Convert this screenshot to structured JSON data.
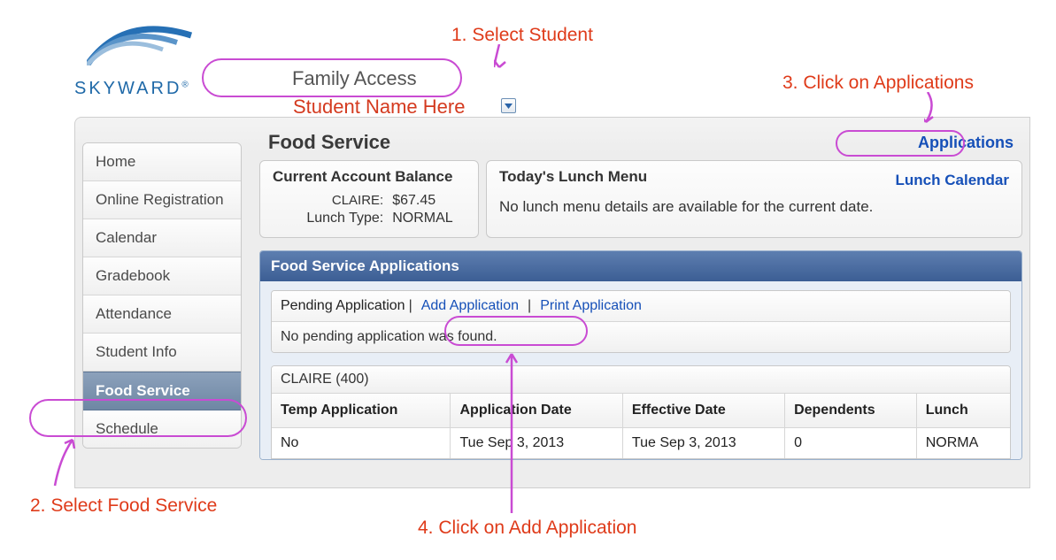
{
  "brand": {
    "name": "SKYWARD",
    "app_title": "Family Access"
  },
  "student_selector": {
    "label": "Student Name Here"
  },
  "sidebar": {
    "items": [
      {
        "label": "Home"
      },
      {
        "label": "Online Registration"
      },
      {
        "label": "Calendar"
      },
      {
        "label": "Gradebook"
      },
      {
        "label": "Attendance"
      },
      {
        "label": "Student Info"
      },
      {
        "label": "Food Service"
      },
      {
        "label": "Schedule"
      }
    ],
    "active_index": 6
  },
  "page": {
    "title": "Food Service",
    "applications_link": "Applications"
  },
  "balance_card": {
    "title": "Current Account Balance",
    "rows": [
      {
        "k": "CLAIRE:",
        "v": "$67.45"
      },
      {
        "k": "Lunch Type:",
        "v": "NORMAL"
      }
    ]
  },
  "lunch_card": {
    "title": "Today's Lunch Menu",
    "calendar_link": "Lunch Calendar",
    "message": "No lunch menu details are available for the current date."
  },
  "apps_panel": {
    "title": "Food Service Applications",
    "tabs": {
      "pending_label": "Pending Application",
      "add_label": "Add Application",
      "print_label": "Print Application"
    },
    "pending_message": "No pending application was found.",
    "student_group": "CLAIRE (400)",
    "columns": [
      "Temp Application",
      "Application Date",
      "Effective Date",
      "Dependents",
      "Lunch "
    ],
    "rows": [
      {
        "temp": "No",
        "app_date": "Tue Sep 3, 2013",
        "eff_date": "Tue Sep 3, 2013",
        "dependents": "0",
        "lunch": "NORMA"
      }
    ]
  },
  "annotations": {
    "a1": "1. Select Student",
    "a2": "2. Select Food Service",
    "a3": "3. Click on Applications",
    "a4": "4. Click on Add Application"
  },
  "colors": {
    "link": "#1650b8",
    "anno": "#df3b1a",
    "oval": "#c94bd3",
    "panel_header": "#3c5e94"
  }
}
